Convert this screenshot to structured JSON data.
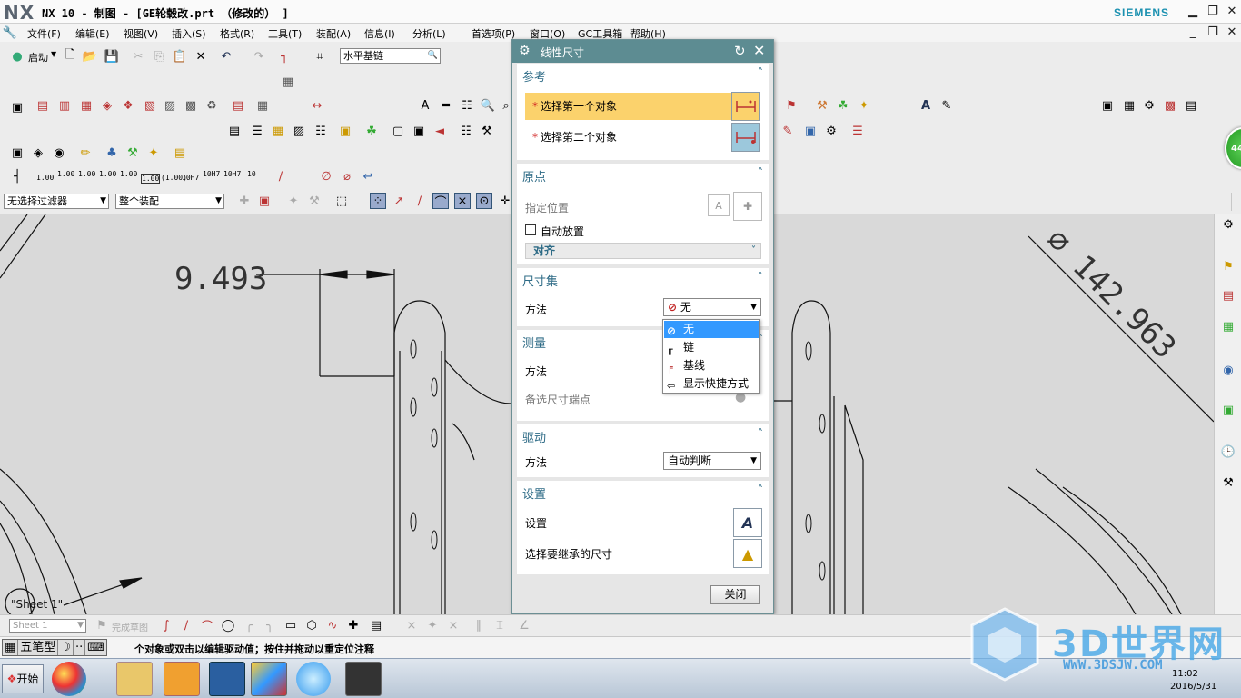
{
  "window": {
    "logo": "NX",
    "title": "NX 10 - 制图 - [GE轮毂改.prt （修改的） ]",
    "brand": "SIEMENS"
  },
  "menu": [
    {
      "label": "文件(F)"
    },
    {
      "label": "编辑(E)"
    },
    {
      "label": "视图(V)"
    },
    {
      "label": "插入(S)"
    },
    {
      "label": "格式(R)"
    },
    {
      "label": "工具(T)"
    },
    {
      "label": "装配(A)"
    },
    {
      "label": "信息(I)"
    },
    {
      "label": "分析(L)"
    },
    {
      "label": "首选项(P)"
    },
    {
      "label": "窗口(O)"
    },
    {
      "label": "GC工具箱"
    },
    {
      "label": "帮助(H)"
    }
  ],
  "toolbar": {
    "start_label": "启动",
    "chain_combo": "水平基链",
    "selection_filter": "无选择过滤器",
    "assembly_scope": "整个装配",
    "tolerance_labels": [
      "1.00",
      "1.00",
      "1.00",
      "1.00",
      "1.00",
      "1.00",
      "(1.00)",
      "10H7",
      "10H7",
      "10H7",
      "10"
    ]
  },
  "drawing": {
    "dim_left": "9.493",
    "dim_right": "142.963",
    "sheet_label": "\"Sheet 1\""
  },
  "dialog": {
    "title": "线性尺寸",
    "groups": {
      "reference": {
        "header": "参考",
        "first_object": "选择第一个对象",
        "second_object": "选择第二个对象"
      },
      "origin": {
        "header": "原点",
        "specify_location": "指定位置",
        "auto_place": "自动放置",
        "align": "对齐"
      },
      "dimension_set": {
        "header": "尺寸集",
        "method_label": "方法",
        "method_value": "无",
        "options": [
          "无",
          "链",
          "基线",
          "显示快捷方式"
        ]
      },
      "measure": {
        "header": "测量",
        "method_label": "方法",
        "alt_endpoint": "备选尺寸端点"
      },
      "driving": {
        "header": "驱动",
        "method_label": "方法",
        "method_value": "自动判断"
      },
      "settings": {
        "header": "设置",
        "settings_label": "设置",
        "inherit_label": "选择要继承的尺寸"
      }
    },
    "close_label": "关闭"
  },
  "sketchbar": {
    "sheet_combo": "Sheet 1",
    "finish_sketch": "完成草图"
  },
  "status": {
    "ime_label": "五笔型",
    "message": "个对象或双击以编辑驱动值；按住并拖动以重定位注释"
  },
  "taskbar": {
    "start_label": "开始",
    "time": "11:02",
    "date": "2016/5/31"
  },
  "badge": "44",
  "watermark": {
    "title": "3D世界网",
    "url": "WWW.3DSJW.COM"
  },
  "colors": {
    "dialog_title": "#5d8c92",
    "group_header": "#2e6b86",
    "selected_row": "#fbd26c",
    "dropdown_highlight": "#3399ff",
    "canvas_bg": "#d9d9d9"
  }
}
